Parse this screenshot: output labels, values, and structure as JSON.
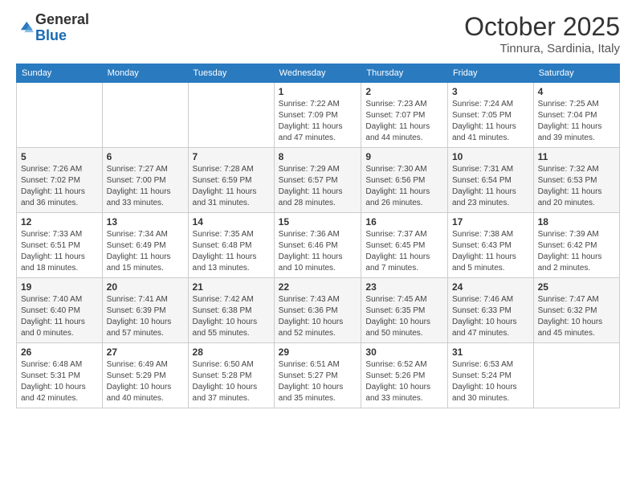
{
  "logo": {
    "general": "General",
    "blue": "Blue"
  },
  "header": {
    "month": "October 2025",
    "location": "Tinnura, Sardinia, Italy"
  },
  "weekdays": [
    "Sunday",
    "Monday",
    "Tuesday",
    "Wednesday",
    "Thursday",
    "Friday",
    "Saturday"
  ],
  "weeks": [
    [
      {
        "day": "",
        "info": ""
      },
      {
        "day": "",
        "info": ""
      },
      {
        "day": "",
        "info": ""
      },
      {
        "day": "1",
        "info": "Sunrise: 7:22 AM\nSunset: 7:09 PM\nDaylight: 11 hours and 47 minutes."
      },
      {
        "day": "2",
        "info": "Sunrise: 7:23 AM\nSunset: 7:07 PM\nDaylight: 11 hours and 44 minutes."
      },
      {
        "day": "3",
        "info": "Sunrise: 7:24 AM\nSunset: 7:05 PM\nDaylight: 11 hours and 41 minutes."
      },
      {
        "day": "4",
        "info": "Sunrise: 7:25 AM\nSunset: 7:04 PM\nDaylight: 11 hours and 39 minutes."
      }
    ],
    [
      {
        "day": "5",
        "info": "Sunrise: 7:26 AM\nSunset: 7:02 PM\nDaylight: 11 hours and 36 minutes."
      },
      {
        "day": "6",
        "info": "Sunrise: 7:27 AM\nSunset: 7:00 PM\nDaylight: 11 hours and 33 minutes."
      },
      {
        "day": "7",
        "info": "Sunrise: 7:28 AM\nSunset: 6:59 PM\nDaylight: 11 hours and 31 minutes."
      },
      {
        "day": "8",
        "info": "Sunrise: 7:29 AM\nSunset: 6:57 PM\nDaylight: 11 hours and 28 minutes."
      },
      {
        "day": "9",
        "info": "Sunrise: 7:30 AM\nSunset: 6:56 PM\nDaylight: 11 hours and 26 minutes."
      },
      {
        "day": "10",
        "info": "Sunrise: 7:31 AM\nSunset: 6:54 PM\nDaylight: 11 hours and 23 minutes."
      },
      {
        "day": "11",
        "info": "Sunrise: 7:32 AM\nSunset: 6:53 PM\nDaylight: 11 hours and 20 minutes."
      }
    ],
    [
      {
        "day": "12",
        "info": "Sunrise: 7:33 AM\nSunset: 6:51 PM\nDaylight: 11 hours and 18 minutes."
      },
      {
        "day": "13",
        "info": "Sunrise: 7:34 AM\nSunset: 6:49 PM\nDaylight: 11 hours and 15 minutes."
      },
      {
        "day": "14",
        "info": "Sunrise: 7:35 AM\nSunset: 6:48 PM\nDaylight: 11 hours and 13 minutes."
      },
      {
        "day": "15",
        "info": "Sunrise: 7:36 AM\nSunset: 6:46 PM\nDaylight: 11 hours and 10 minutes."
      },
      {
        "day": "16",
        "info": "Sunrise: 7:37 AM\nSunset: 6:45 PM\nDaylight: 11 hours and 7 minutes."
      },
      {
        "day": "17",
        "info": "Sunrise: 7:38 AM\nSunset: 6:43 PM\nDaylight: 11 hours and 5 minutes."
      },
      {
        "day": "18",
        "info": "Sunrise: 7:39 AM\nSunset: 6:42 PM\nDaylight: 11 hours and 2 minutes."
      }
    ],
    [
      {
        "day": "19",
        "info": "Sunrise: 7:40 AM\nSunset: 6:40 PM\nDaylight: 11 hours and 0 minutes."
      },
      {
        "day": "20",
        "info": "Sunrise: 7:41 AM\nSunset: 6:39 PM\nDaylight: 10 hours and 57 minutes."
      },
      {
        "day": "21",
        "info": "Sunrise: 7:42 AM\nSunset: 6:38 PM\nDaylight: 10 hours and 55 minutes."
      },
      {
        "day": "22",
        "info": "Sunrise: 7:43 AM\nSunset: 6:36 PM\nDaylight: 10 hours and 52 minutes."
      },
      {
        "day": "23",
        "info": "Sunrise: 7:45 AM\nSunset: 6:35 PM\nDaylight: 10 hours and 50 minutes."
      },
      {
        "day": "24",
        "info": "Sunrise: 7:46 AM\nSunset: 6:33 PM\nDaylight: 10 hours and 47 minutes."
      },
      {
        "day": "25",
        "info": "Sunrise: 7:47 AM\nSunset: 6:32 PM\nDaylight: 10 hours and 45 minutes."
      }
    ],
    [
      {
        "day": "26",
        "info": "Sunrise: 6:48 AM\nSunset: 5:31 PM\nDaylight: 10 hours and 42 minutes."
      },
      {
        "day": "27",
        "info": "Sunrise: 6:49 AM\nSunset: 5:29 PM\nDaylight: 10 hours and 40 minutes."
      },
      {
        "day": "28",
        "info": "Sunrise: 6:50 AM\nSunset: 5:28 PM\nDaylight: 10 hours and 37 minutes."
      },
      {
        "day": "29",
        "info": "Sunrise: 6:51 AM\nSunset: 5:27 PM\nDaylight: 10 hours and 35 minutes."
      },
      {
        "day": "30",
        "info": "Sunrise: 6:52 AM\nSunset: 5:26 PM\nDaylight: 10 hours and 33 minutes."
      },
      {
        "day": "31",
        "info": "Sunrise: 6:53 AM\nSunset: 5:24 PM\nDaylight: 10 hours and 30 minutes."
      },
      {
        "day": "",
        "info": ""
      }
    ]
  ]
}
